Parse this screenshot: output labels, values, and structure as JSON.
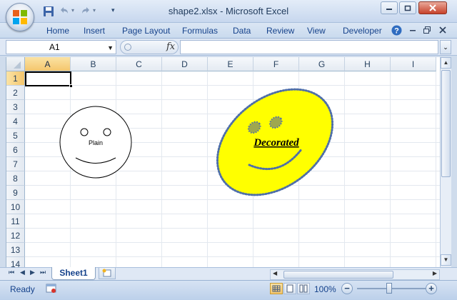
{
  "window": {
    "title": "shape2.xlsx - Microsoft Excel"
  },
  "ribbon": {
    "tabs": [
      "Home",
      "Insert",
      "Page Layout",
      "Formulas",
      "Data",
      "Review",
      "View",
      "Developer"
    ]
  },
  "formula_bar": {
    "name_box": "A1",
    "fx": "fx",
    "formula": ""
  },
  "grid": {
    "columns": [
      "A",
      "B",
      "C",
      "D",
      "E",
      "F",
      "G",
      "H",
      "I"
    ],
    "rows": [
      "1",
      "2",
      "3",
      "4",
      "5",
      "6",
      "7",
      "8",
      "9",
      "10",
      "11",
      "12",
      "13",
      "14"
    ],
    "active_cell": "A1"
  },
  "shapes": {
    "plain": {
      "label": "Plain",
      "fill": "#ffffff",
      "stroke": "#000000"
    },
    "decorated": {
      "label": "Decorated",
      "fill": "#ffff00",
      "stroke": "#4f6fa8",
      "stroke_style": "dotted"
    }
  },
  "sheets": {
    "tabs": [
      "Sheet1"
    ]
  },
  "status": {
    "text": "Ready",
    "zoom": "100%",
    "zoom_level": 100
  },
  "colors": {
    "accent": "#15428b",
    "selection": "#f4c66d"
  }
}
